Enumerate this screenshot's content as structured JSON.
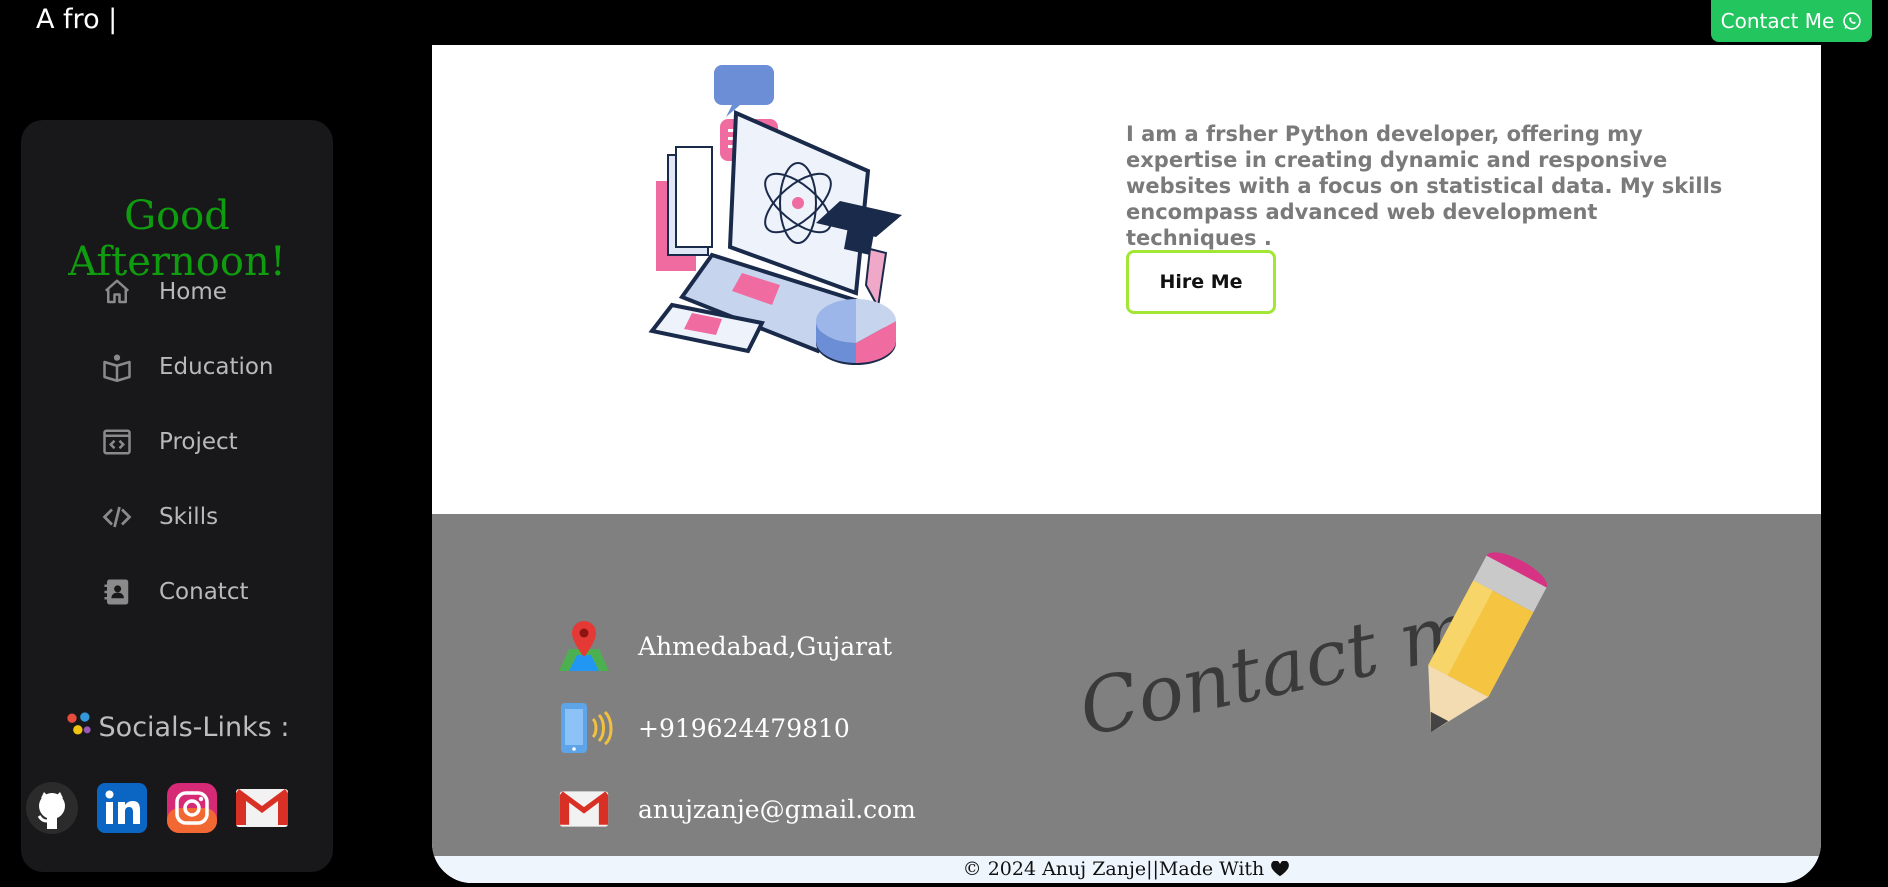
{
  "header": {
    "brand": "A fro |",
    "contact_button": "Contact Me",
    "accent": "#22c55e"
  },
  "sidebar": {
    "greeting": "Good Afternoon!",
    "greeting_color": "#0f9d0f",
    "items": [
      {
        "label": "Home",
        "icon": "home-icon"
      },
      {
        "label": "Education",
        "icon": "book-reader-icon"
      },
      {
        "label": "Project",
        "icon": "code-window-icon"
      },
      {
        "label": "Skills",
        "icon": "code-icon"
      },
      {
        "label": "Conatct",
        "icon": "address-book-icon"
      }
    ],
    "socials_title": "Socials-Links :",
    "socials": [
      {
        "name": "GitHub",
        "icon": "github-icon"
      },
      {
        "name": "LinkedIn",
        "icon": "linkedin-icon"
      },
      {
        "name": "Instagram",
        "icon": "instagram-icon"
      },
      {
        "name": "Gmail",
        "icon": "gmail-icon"
      }
    ]
  },
  "hero": {
    "description": "I am a frsher Python developer, offering my expertise in creating dynamic and responsive websites with a focus on statistical data. My skills encompass advanced web development techniques .",
    "hire_button": "Hire Me"
  },
  "contact": {
    "location": "Ahmedabad,Gujarat",
    "phone": "+919624479810",
    "email": "anujzanje@gmail.com",
    "art_text": "Contact me"
  },
  "footer": {
    "text": "© 2024 Anuj Zanje||Made With"
  }
}
